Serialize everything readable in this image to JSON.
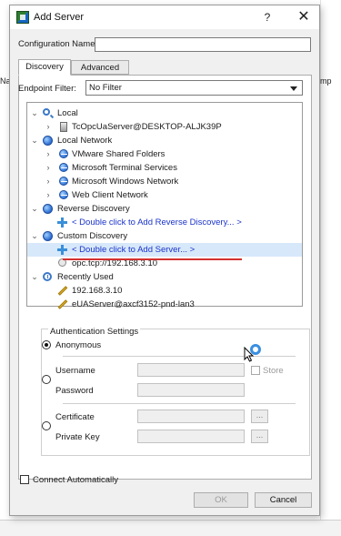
{
  "background": {
    "left_text": "Na",
    "right_text": "mp"
  },
  "window": {
    "title": "Add Server",
    "help_glyph": "?",
    "close_glyph": "✕"
  },
  "config": {
    "label": "Configuration Name",
    "value": ""
  },
  "tabs": [
    {
      "label": "Discovery",
      "active": true
    },
    {
      "label": "Advanced",
      "active": false
    }
  ],
  "endpoint_filter": {
    "label": "Endpoint Filter:",
    "value": "No Filter"
  },
  "tree": {
    "items": [
      {
        "toggle": "⌄",
        "icon": "search-icon",
        "label": "Local",
        "link": false
      },
      {
        "toggle": "›",
        "icon": "server-icon",
        "label": "TcOpcUaServer@DESKTOP-ALJK39P",
        "link": false
      },
      {
        "toggle": "⌄",
        "icon": "globe-icon",
        "label": "Local Network",
        "link": false
      },
      {
        "toggle": "›",
        "icon": "network-icon",
        "label": "VMware Shared Folders",
        "link": false
      },
      {
        "toggle": "›",
        "icon": "network-icon",
        "label": "Microsoft Terminal Services",
        "link": false
      },
      {
        "toggle": "›",
        "icon": "network-icon",
        "label": "Microsoft Windows Network",
        "link": false
      },
      {
        "toggle": "›",
        "icon": "network-icon",
        "label": "Web Client Network",
        "link": false
      },
      {
        "toggle": "⌄",
        "icon": "globe-icon",
        "label": "Reverse Discovery",
        "link": false
      },
      {
        "toggle": "",
        "icon": "plus-icon",
        "label": "< Double click to Add Reverse Discovery... >",
        "link": true
      },
      {
        "toggle": "⌄",
        "icon": "globe-icon",
        "label": "Custom Discovery",
        "link": false
      },
      {
        "toggle": "",
        "icon": "plus-icon",
        "label": "< Double click to Add Server... >",
        "link": true,
        "selected": true
      },
      {
        "toggle": "",
        "icon": "link-icon",
        "label": "opc.tcp://192.168.3.10",
        "link": false
      },
      {
        "toggle": "⌄",
        "icon": "clock-icon",
        "label": "Recently Used",
        "link": false
      },
      {
        "toggle": "",
        "icon": "pencil-icon",
        "label": "192.168.3.10",
        "link": false
      },
      {
        "toggle": "",
        "icon": "pencil-icon",
        "label": "eUAServer@axcf3152-pnd-lan3",
        "link": false
      }
    ]
  },
  "auth": {
    "title": "Authentication Settings",
    "anonymous": "Anonymous",
    "username": "Username",
    "password": "Password",
    "store": "Store",
    "certificate": "Certificate",
    "private_key": "Private Key",
    "browse": "..."
  },
  "connect_automatically": "Connect Automatically",
  "buttons": {
    "ok": "OK",
    "cancel": "Cancel"
  },
  "colors": {
    "link": "#1a33c9",
    "selection": "#d7e8fa",
    "highlight_underline": "#d43131"
  }
}
